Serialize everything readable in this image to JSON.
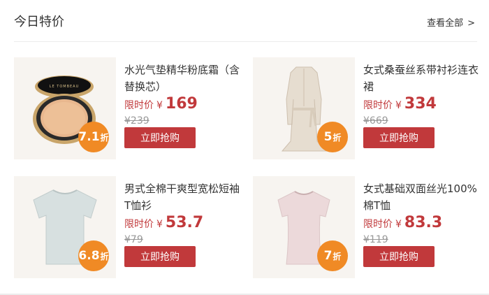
{
  "section": {
    "title": "今日特价",
    "view_all": "查看全部",
    "view_all_arrow": ">"
  },
  "products": [
    {
      "name": "水光气垫精华粉底霜（含替换芯）",
      "price_label": "限时价",
      "currency": "¥",
      "price": "169",
      "original_price": "¥239",
      "discount": "7.1",
      "discount_unit": "折",
      "buy_label": "立即抢购",
      "logo_text": "LE TOMBEAU"
    },
    {
      "name": "女式桑蚕丝系带衬衫连衣裙",
      "price_label": "限时价",
      "currency": "¥",
      "price": "334",
      "original_price": "¥669",
      "discount": "5",
      "discount_unit": "折",
      "buy_label": "立即抢购"
    },
    {
      "name": "男式全棉干爽型宽松短袖T恤衫",
      "price_label": "限时价",
      "currency": "¥",
      "price": "53.7",
      "original_price": "¥79",
      "discount": "6.8",
      "discount_unit": "折",
      "buy_label": "立即抢购"
    },
    {
      "name": "女式基础双面丝光100%棉T恤",
      "price_label": "限时价",
      "currency": "¥",
      "price": "83.3",
      "original_price": "¥119",
      "discount": "7",
      "discount_unit": "折",
      "buy_label": "立即抢购"
    }
  ],
  "colors": {
    "accent_red": "#c1393b",
    "discount_orange": "#f08a25",
    "thumb_bg": "#f7f4f0"
  }
}
